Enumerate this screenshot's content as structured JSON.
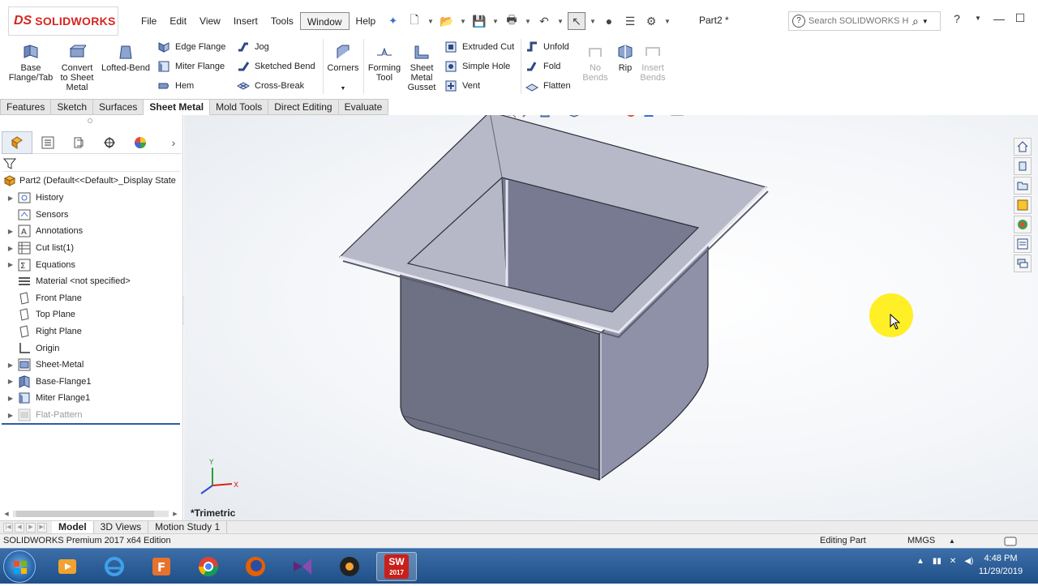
{
  "app": {
    "logo_ds": "DS",
    "logo_text": "SOLIDWORKS",
    "doc_title": "Part2 *"
  },
  "menu": [
    "File",
    "Edit",
    "View",
    "Insert",
    "Tools",
    "Window",
    "Help"
  ],
  "search": {
    "placeholder": "Search SOLIDWORKS Help"
  },
  "ribbon": {
    "base_flange": "Base Flange/Tab",
    "convert": "Convert to Sheet Metal",
    "lofted_bend": "Lofted-Bend",
    "edge_flange": "Edge Flange",
    "miter_flange": "Miter Flange",
    "hem": "Hem",
    "jog": "Jog",
    "sketched_bend": "Sketched Bend",
    "cross_break": "Cross-Break",
    "corners": "Corners",
    "forming_tool": "Forming Tool",
    "gusset": "Sheet Metal Gusset",
    "extruded_cut": "Extruded Cut",
    "simple_hole": "Simple Hole",
    "vent": "Vent",
    "unfold": "Unfold",
    "fold": "Fold",
    "flatten": "Flatten",
    "no_bends": "No Bends",
    "rip": "Rip",
    "insert_bends": "Insert Bends"
  },
  "command_tabs": [
    "Features",
    "Sketch",
    "Surfaces",
    "Sheet Metal",
    "Mold Tools",
    "Direct Editing",
    "Evaluate"
  ],
  "tree": {
    "root": "Part2  (Default<<Default>_Display State",
    "items": [
      {
        "label": "History"
      },
      {
        "label": "Sensors"
      },
      {
        "label": "Annotations"
      },
      {
        "label": "Cut list(1)"
      },
      {
        "label": "Equations"
      },
      {
        "label": "Material <not specified>"
      },
      {
        "label": "Front Plane"
      },
      {
        "label": "Top Plane"
      },
      {
        "label": "Right Plane"
      },
      {
        "label": "Origin"
      },
      {
        "label": "Sheet-Metal"
      },
      {
        "label": "Base-Flange1"
      },
      {
        "label": "Miter Flange1"
      },
      {
        "label": "Flat-Pattern"
      }
    ]
  },
  "viewport": {
    "view_name": "*Trimetric",
    "axis_x": "X",
    "axis_y": "Y"
  },
  "bottom_tabs": [
    "Model",
    "3D Views",
    "Motion Study 1"
  ],
  "status": {
    "edition": "SOLIDWORKS Premium 2017 x64 Edition",
    "mode": "Editing Part",
    "units": "MMGS",
    "units_arrow": "▲"
  },
  "taskbar": {
    "time": "4:48 PM",
    "date": "11/29/2019",
    "sw_label": "SW",
    "sw_year": "2017"
  },
  "colors": {
    "accent": "#d6261e",
    "part_face": "#777a90",
    "taskbar": "#245690"
  }
}
